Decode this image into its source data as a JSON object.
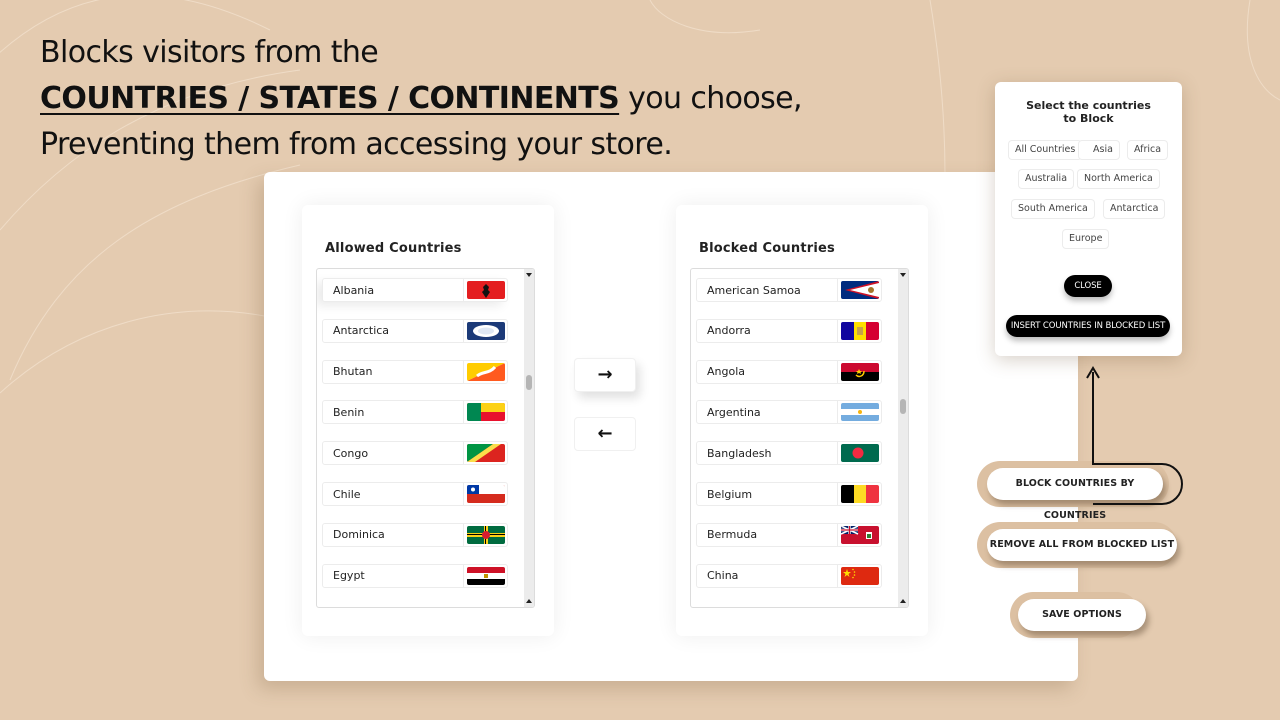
{
  "headline": {
    "line1": "Blocks visitors from the",
    "line2_strong": "COUNTRIES / STATES / CONTINENTS",
    "line2_rest": " you choose,",
    "line3": "Preventing them from accessing your store."
  },
  "allowed": {
    "title": "Allowed Countries",
    "countries": [
      {
        "name": "Albania",
        "flag": "albania-flag"
      },
      {
        "name": "Antarctica",
        "flag": "antarctica-flag"
      },
      {
        "name": "Bhutan",
        "flag": "bhutan-flag"
      },
      {
        "name": "Benin",
        "flag": "benin-flag"
      },
      {
        "name": "Congo",
        "flag": "congo-flag"
      },
      {
        "name": "Chile",
        "flag": "chile-flag"
      },
      {
        "name": "Dominica",
        "flag": "dominica-flag"
      },
      {
        "name": "Egypt",
        "flag": "egypt-flag"
      }
    ]
  },
  "blocked": {
    "title": "Blocked Countries",
    "countries": [
      {
        "name": "American Samoa",
        "flag": "american-samoa-flag"
      },
      {
        "name": "Andorra",
        "flag": "andorra-flag"
      },
      {
        "name": "Angola",
        "flag": "angola-flag"
      },
      {
        "name": "Argentina",
        "flag": "argentina-flag"
      },
      {
        "name": "Bangladesh",
        "flag": "bangladesh-flag"
      },
      {
        "name": "Belgium",
        "flag": "belgium-flag"
      },
      {
        "name": "Bermuda",
        "flag": "bermuda-flag"
      },
      {
        "name": "China",
        "flag": "china-flag"
      }
    ]
  },
  "transfer": {
    "move_right_icon": "→",
    "move_left_icon": "←"
  },
  "popup": {
    "title_line1": "Select the countries",
    "title_line2": "to Block",
    "chips": [
      "All Countries",
      "Asia",
      "Africa",
      "Australia",
      "North America",
      "South America",
      "Antarctica",
      "Europe"
    ],
    "close_label": "CLOSE",
    "insert_label": "INSERT COUNTRIES IN BLOCKED LIST"
  },
  "actions": {
    "block_by_countries": "BLOCK COUNTRIES BY COUNTRIES",
    "remove_all": "REMOVE ALL FROM BLOCKED LIST",
    "save_options": "SAVE OPTIONS"
  },
  "colors": {
    "background": "#e4cbb0",
    "frame_accent": "#dcc0a2",
    "dark_button": "#000000"
  }
}
